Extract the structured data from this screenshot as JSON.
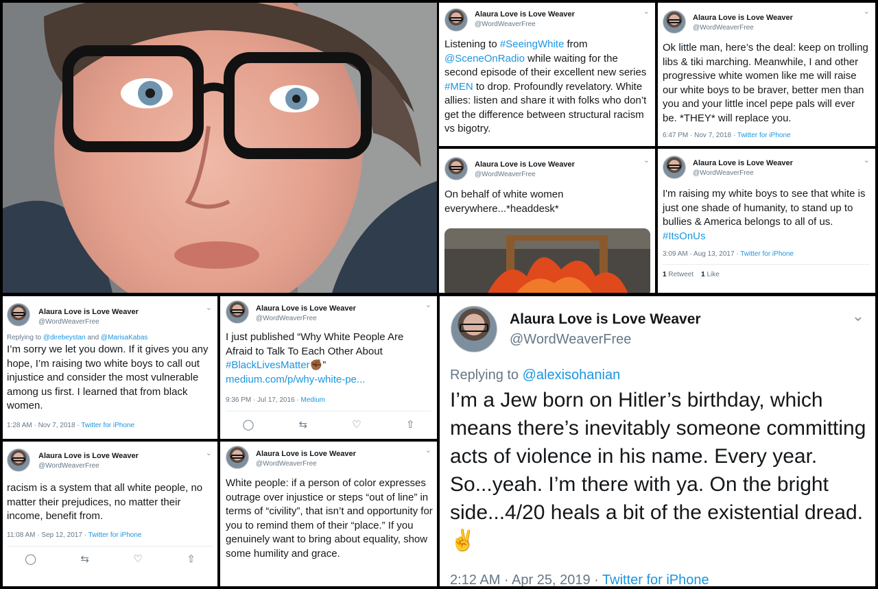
{
  "profile": {
    "display_name": "Alaura Love is Love Weaver",
    "handle": "@WordWeaverFree"
  },
  "tweets": [
    {
      "body": [
        "Listening to ",
        {
          "link": "#SeeingWhite"
        },
        " from ",
        {
          "link": "@SceneOnRadio"
        },
        " while waiting for the second episode of their excellent new series ",
        {
          "link": "#MEN"
        },
        " to drop. Profoundly revelatory. White allies: listen and share it with folks who don’t get the difference between structural racism vs bigotry."
      ]
    },
    {
      "body": "Ok little man, here’s the deal: keep on trolling libs & tiki marching. Meanwhile, I and other progressive white women like me will raise our white boys to be braver, better men than you and your little incel pepe pals will ever be. *THEY* will replace you.",
      "time": "6:47 PM · Nov 7, 2018",
      "source": "Twitter for iPhone"
    },
    {
      "body": "On behalf of white women everywhere...*headdesk*"
    },
    {
      "body": "I'm raising my white boys to see that white is just one shade of humanity, to stand up to bullies & America belongs to all of us.",
      "hashtag": "#ItsOnUs",
      "time": "3:09 AM · Aug 13, 2017",
      "source": "Twitter for iPhone",
      "retweets": "1",
      "retweets_label": "Retweet",
      "likes": "1",
      "likes_label": "Like"
    },
    {
      "replying_prefix": "Replying to ",
      "replying_to_1": "@direbeystan",
      "replying_and": " and ",
      "replying_to_2": "@MarisaKabas",
      "body": "I’m sorry we let you down. If it gives you any hope, I’m raising two white boys to call out injustice and consider the most vulnerable among us first. I learned that from black women.",
      "time": "1:28 AM · Nov 7, 2018",
      "source": "Twitter for iPhone"
    },
    {
      "body": "I just published “Why White People Are Afraid to Talk To Each Other About",
      "hashtag": "#BlackLivesMatter",
      "emoji": "✊🏾",
      "quote_close": "”",
      "url": "medium.com/p/why-white-pe...",
      "time": "9:36 PM · Jul 17, 2016",
      "source": "Medium"
    },
    {
      "body": "racism is a system that all white people, no matter their prejudices, no matter their income, benefit from.",
      "time": "11:08 AM · Sep 12, 2017",
      "source": "Twitter for iPhone"
    },
    {
      "body": "White people: if a person of color expresses outrage over injustice or steps “out of line” in terms of “civility”, that isn’t and opportunity for you to remind them of their “place.” If you genuinely want to bring about equality, show some humility and grace."
    },
    {
      "replying_prefix": "Replying to ",
      "replying_to_1": "@alexisohanian",
      "body": "I’m a Jew born on Hitler’s birthday, which means there’s inevitably someone committing acts of violence in his name. Every year. So...yeah. I’m there with ya. On the bright side...4/20 heals a bit of the existential dread.",
      "emoji": "✌️",
      "time": "2:12 AM · Apr 25, 2019",
      "source": "Twitter for iPhone"
    }
  ],
  "icons": {
    "chevron": "chevron-down-icon",
    "reply": "reply-icon",
    "retweet": "retweet-icon",
    "like": "heart-icon",
    "share": "share-icon"
  },
  "colors": {
    "link": "#1b95e0",
    "meta": "#657786",
    "text": "#14171a"
  }
}
